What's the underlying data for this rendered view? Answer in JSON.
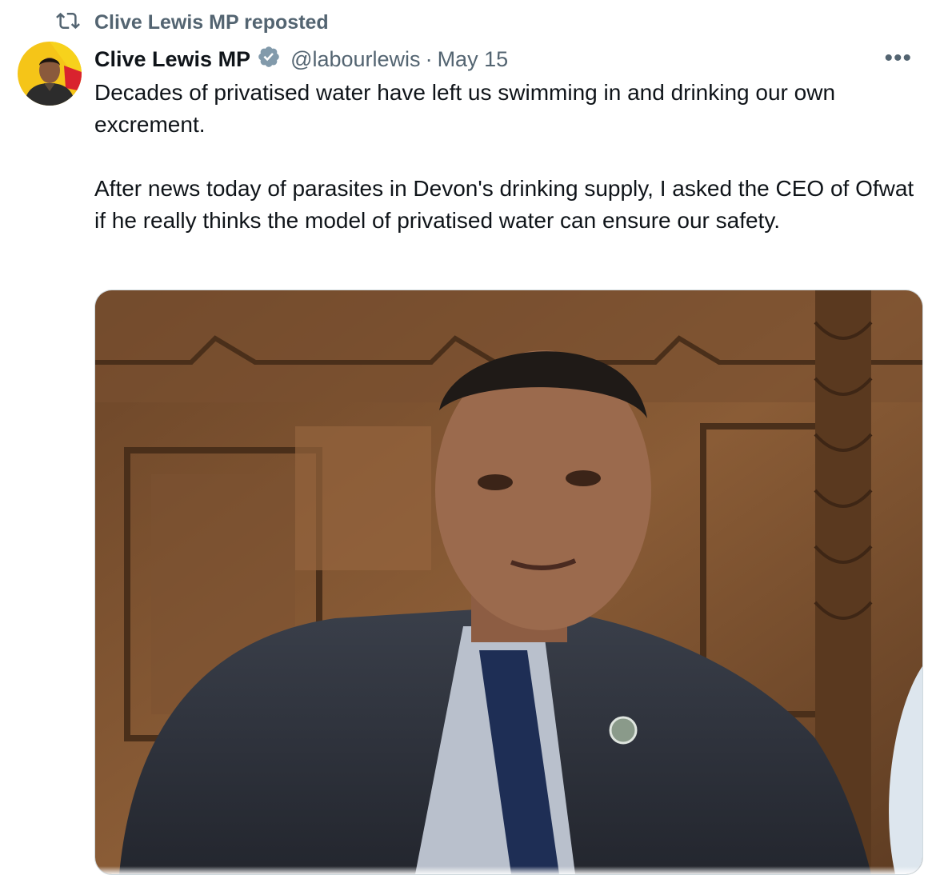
{
  "repost": {
    "icon": "repost-icon",
    "label": "Clive Lewis MP reposted"
  },
  "tweet": {
    "author_name": "Clive Lewis MP",
    "verified_icon": "verified-badge-icon",
    "handle": "@labourlewis",
    "separator": "·",
    "date": "May 15",
    "more_icon": "more-options-icon",
    "more_label": "•••",
    "paragraphs": [
      "Decades of privatised water have left us swimming in and drinking our own excrement.",
      "After news today of parasites in Devon's drinking supply, I asked the CEO of Ofwat if he really thinks the model of privatised water can ensure our safety."
    ]
  },
  "colors": {
    "text_primary": "#0f1419",
    "text_secondary": "#536471",
    "verified_badge": "#829aab",
    "border": "#cfd9de"
  }
}
